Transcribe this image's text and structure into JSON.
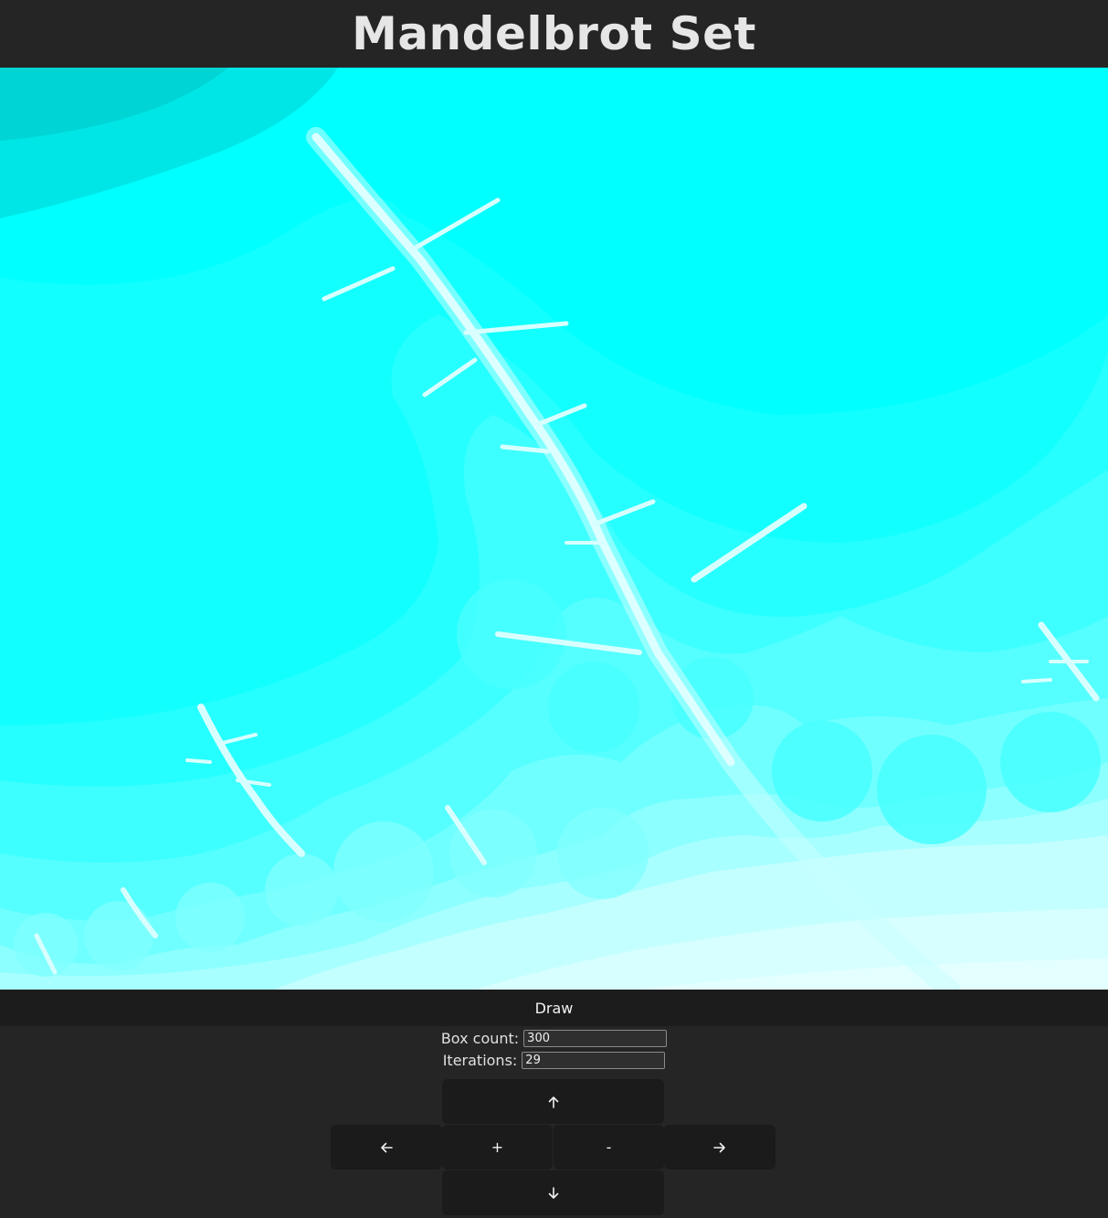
{
  "header": {
    "title": "Mandelbrot Set"
  },
  "canvas": {
    "description_icon": "mandelbrot-render",
    "palette": [
      "#00ffff",
      "#1affff",
      "#33ffff",
      "#4dffff",
      "#6effff",
      "#92ffff",
      "#b6ffff",
      "#d4ffff",
      "#e6ffff",
      "#00d6d6",
      "#00e3e3"
    ]
  },
  "controls": {
    "draw_label": "Draw",
    "box_count": {
      "label": "Box count:",
      "value": "300"
    },
    "iterations": {
      "label": "Iterations:",
      "value": "29"
    },
    "up": {
      "icon": "arrow-up-icon"
    },
    "left": {
      "icon": "arrow-left-icon"
    },
    "zoom_in_label": "+",
    "zoom_out_label": "-",
    "right": {
      "icon": "arrow-right-icon"
    },
    "down": {
      "icon": "arrow-down-icon"
    }
  }
}
